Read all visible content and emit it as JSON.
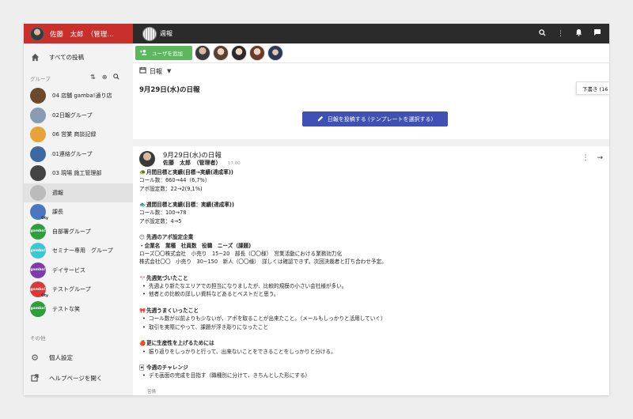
{
  "user": {
    "name": "佐藤　太郎　（管理..."
  },
  "sidebar": {
    "all_posts": "すべての投稿",
    "groups_label": "グループ",
    "groups": [
      {
        "label": "04 店舗 gamba!通り店",
        "color": "#6b4a2a"
      },
      {
        "label": "02日報グループ",
        "color": "#8a9bb5"
      },
      {
        "label": "06 営業 商談記録",
        "color": "#e8a23a"
      },
      {
        "label": "01連絡グループ",
        "color": "#3a6aa0"
      },
      {
        "label": "03 現場 施工管理部",
        "color": "#444444"
      },
      {
        "label": "週報",
        "color": "#bbbbbb",
        "active": true
      },
      {
        "label": "課長",
        "color": "#4a78c0",
        "badge": "Oty"
      },
      {
        "label": "自部署グループ",
        "color": "#2e9e3e",
        "thumb_text": "gamba!"
      },
      {
        "label": "セミナー専用　グループ",
        "color": "#3fc6d0",
        "thumb_text": "gamba!"
      },
      {
        "label": "デイサービス",
        "color": "#7b3ea8",
        "thumb_text": "gamba!"
      },
      {
        "label": "テストグループ",
        "color": "#d83a3a",
        "thumb_text": "gamba!",
        "badge": "Oty"
      },
      {
        "label": "テストな笑",
        "color": "#2e9e3e",
        "thumb_text": "gamba!"
      }
    ],
    "other_label": "その他",
    "settings": "個人設定",
    "help": "ヘルプページを開く"
  },
  "topbar": {
    "title": "週報"
  },
  "memberbar": {
    "add_user": "ユーザを追加"
  },
  "typebar": {
    "selected": "日報"
  },
  "date_card": {
    "title": "9月29日(水)の日報",
    "draft": "下書き (16",
    "post_button": "日報を投稿する (テンプレートを選択する)"
  },
  "post": {
    "title": "9月29日(水)の日報",
    "author": "佐藤　太郎　（管理者）",
    "time": "17:00",
    "s1_head": "月間目標と実績(目標→実績(達成率))",
    "s1_l1": "コール数：660→44（6,7%）",
    "s1_l2": "アポ設定数：22→2(9,1%)",
    "s2_head": "週間目標と実績(目標：実績(達成率))",
    "s2_l1": "コール数：100→78",
    "s2_l2": "アポ設定数：4→5",
    "s3_head": "先週のアポ設定企業",
    "s3_l1": "・企業名　業種　社員数　役職　ニーズ（課題)",
    "s3_l2": "ローズ〇〇株式会社　小売り　15~20　部長（〇〇様）　営業活動における業務効力化",
    "s3_l3": "株式会社〇〇　小売り　30~150　新人（〇〇様）　詳しくは確認できず。次回決裁者と打ち合わせ予定。",
    "s4_head": "先週気づいたこと",
    "s4_b1": "先週より新たなエリアでの担当になりましたが、比較的規模の小さい会社様が多い。",
    "s4_b2": "他者との比較の詳しい資料などあるとベストだと思う。",
    "s5_head": "先週うまくいったこと",
    "s5_b1": "コール数が以前よりも少ないが、アポを取ることが出来たこと。（メールもしっかりと活用していく）",
    "s5_b2": "取引を実際にやって、課題が浮き彫りになったこと",
    "s6_head": "更に生産性を上げるためには",
    "s6_b1": "振り返りをしっかりと行って、出来ないことをできることをしっかりと分ける。",
    "s7_head": "今週のチャレンジ",
    "s7_b1": "デモ画面の完成を目指す（職種別に分けて、きちんとした形にする)",
    "footer": "苦情"
  },
  "colors": {
    "user_header": "#c9302c",
    "topbar": "#2b2b2b",
    "add_user": "#5cb85c",
    "post_button": "#3f51b5"
  }
}
